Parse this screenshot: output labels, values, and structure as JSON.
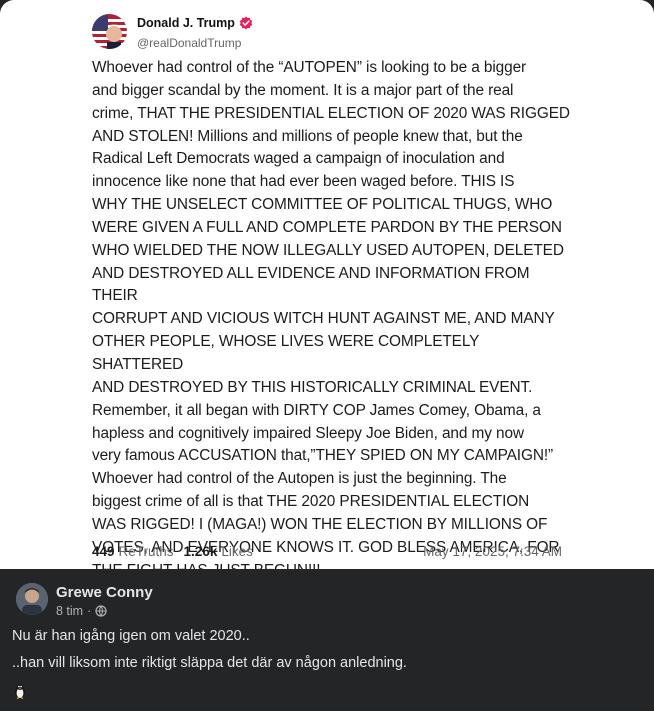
{
  "truth_post": {
    "author_name": "Donald J. Trump",
    "handle": "@realDonaldTrump",
    "text": "Whoever had control of the “AUTOPEN” is looking to be a bigger\nand bigger scandal by the moment. It is a major part of the real\ncrime, THAT THE PRESIDENTIAL ELECTION OF 2020 WAS RIGGED\nAND STOLEN! Millions and millions of people knew that, but the\nRadical Left Democrats waged a campaign of inoculation and\ninnocence like none that had ever been waged before. THIS IS\nWHY THE UNSELECT COMMITTEE OF POLITICAL THUGS, WHO\nWERE GIVEN A FULL AND COMPLETE PARDON BY THE PERSON\nWHO WIELDED THE NOW ILLEGALLY USED AUTOPEN, DELETED\nAND DESTROYED ALL EVIDENCE AND INFORMATION FROM THEIR\nCORRUPT AND VICIOUS WITCH HUNT AGAINST ME, AND MANY\nOTHER PEOPLE, WHOSE LIVES WERE COMPLETELY SHATTERED\nAND DESTROYED BY THIS HISTORICALLY CRIMINAL EVENT.\nRemember, it all began with DIRTY COP James Comey, Obama, a\nhapless and cognitively impaired Sleepy Joe Biden, and my now\nvery famous ACCUSATION that,”THEY SPIED ON MY CAMPAIGN!”\nWhoever had control of the  Autopen is just the beginning. The\nbiggest crime of all is that THE 2020 PRESIDENTIAL ELECTION\nWAS RIGGED! I (MAGA!) WON THE ELECTION BY MILLIONS OF\nVOTES, AND EVERYONE KNOWS IT. GOD BLESS AMERICA, FOR\nTHE FIGHT HAS JUST BEGUN!!!",
    "retruths_count": "449",
    "retruths_label": "ReTruths",
    "likes_count": "1.26k",
    "likes_label": "Likes",
    "date": "May 17, 2025, 7:34 AM",
    "verified_color": "#e0245e"
  },
  "fb_post": {
    "author_name": "Grewe Conny",
    "time": "8 tim",
    "separator": "·",
    "privacy_icon": "globe-icon",
    "line1": "Nu är han igång igen om valet 2020..",
    "line2": "..han vill liksom inte riktigt släppa det där av någon anledning.",
    "emoji_icon": "penguin-icon"
  },
  "colors": {
    "fb_background": "#242526",
    "fb_text": "#e4e6eb",
    "fb_secondary": "#b0b3b8"
  }
}
